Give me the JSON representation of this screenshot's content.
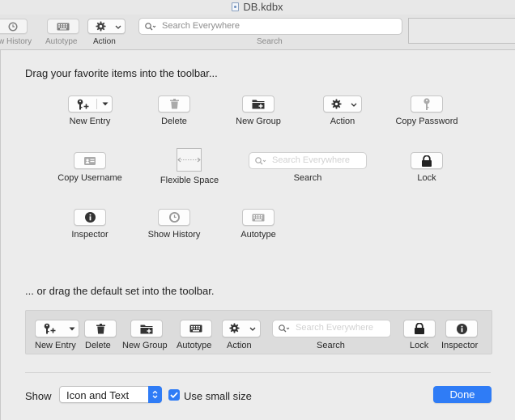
{
  "window": {
    "title": "DB.kdbx"
  },
  "toolbar": {
    "items": [
      {
        "label": "w History",
        "icon": "clock-icon"
      },
      {
        "label": "Autotype",
        "icon": "keyboard-icon"
      },
      {
        "label": "Action",
        "icon": "gear-icon"
      }
    ],
    "search": {
      "placeholder": "Search Everywhere",
      "label": "Search"
    }
  },
  "sheet": {
    "heading_favorites": "Drag your favorite items into the toolbar...",
    "favorites": [
      {
        "label": "New Entry",
        "icon": "key-plus-icon"
      },
      {
        "label": "Delete",
        "icon": "trash-icon"
      },
      {
        "label": "New Group",
        "icon": "folder-plus-icon"
      },
      {
        "label": "Action",
        "icon": "gear-icon"
      },
      {
        "label": "Copy Password",
        "icon": "key-icon"
      },
      {
        "label": "Copy Username",
        "icon": "id-card-icon"
      },
      {
        "label": "Flexible Space",
        "icon": "flexible-space-icon"
      },
      {
        "label": "Search",
        "placeholder": "Search Everywhere"
      },
      {
        "label": "Lock",
        "icon": "lock-icon"
      },
      {
        "label": "Inspector",
        "icon": "info-icon"
      },
      {
        "label": "Show History",
        "icon": "clock-icon"
      },
      {
        "label": "Autotype",
        "icon": "keyboard-icon"
      }
    ],
    "heading_default": "... or drag the default set into the toolbar.",
    "default_set": [
      {
        "label": "New Entry"
      },
      {
        "label": "Delete"
      },
      {
        "label": "New Group"
      },
      {
        "label": "Autotype"
      },
      {
        "label": "Action"
      },
      {
        "label": "Search",
        "placeholder": "Search Everywhere"
      },
      {
        "label": "Lock"
      },
      {
        "label": "Inspector"
      }
    ],
    "footer": {
      "show_label": "Show",
      "show_value": "Icon and Text",
      "small_size_label": "Use small size",
      "small_size_checked": true,
      "done_label": "Done"
    }
  },
  "colors": {
    "accent": "#2f7cf6"
  }
}
